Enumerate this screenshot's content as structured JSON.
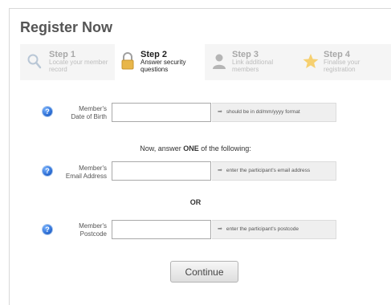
{
  "page": {
    "title": "Register Now"
  },
  "steps": [
    {
      "number": "Step 1",
      "desc_line1": "Locate your member",
      "desc_line2": "record",
      "icon": "magnifier-icon",
      "state": "inactive"
    },
    {
      "number": "Step 2",
      "desc_line1": "Answer security",
      "desc_line2": "questions",
      "icon": "padlock-icon",
      "state": "active"
    },
    {
      "number": "Step 3",
      "desc_line1": "Link additional",
      "desc_line2": "members",
      "icon": "person-icon",
      "state": "inactive"
    },
    {
      "number": "Step 4",
      "desc_line1": "Finalise your",
      "desc_line2": "registration",
      "icon": "star-icon",
      "state": "inactive"
    }
  ],
  "form": {
    "dob": {
      "label_line1": "Member's",
      "label_line2": "Date of Birth",
      "value": "",
      "hint": "should be in dd/mm/yyyy format"
    },
    "instruction": {
      "before": "Now, answer ",
      "emphasis": "ONE",
      "after": " of the following:"
    },
    "email": {
      "label_line1": "Member's",
      "label_line2": "Email Address",
      "value": "",
      "hint": "enter the participant's email address"
    },
    "separator": "OR",
    "postcode": {
      "label_line1": "Member's",
      "label_line2": "Postcode",
      "value": "",
      "hint": "enter the participant's postcode"
    },
    "help_glyph": "?",
    "hint_arrow": "➡",
    "continue_label": "Continue"
  },
  "colors": {
    "help_icon": "#2d6fd6",
    "steps_bar": "#f5f5f5",
    "hint_box": "#efefef",
    "star": "#f6c343",
    "padlock": "#e8b64a"
  }
}
